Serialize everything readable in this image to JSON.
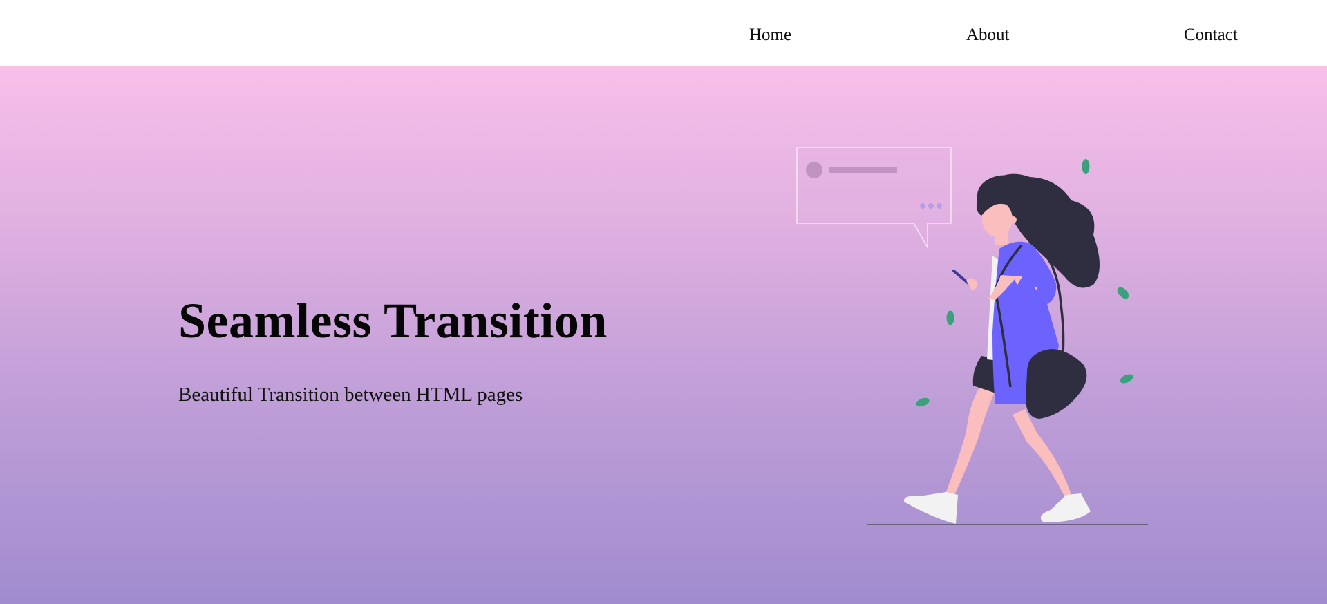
{
  "nav": {
    "items": [
      {
        "label": "Home"
      },
      {
        "label": "About"
      },
      {
        "label": "Contact"
      }
    ]
  },
  "hero": {
    "title": "Seamless Transition",
    "subtitle": "Beautiful Transition between HTML pages",
    "gradient_colors": [
      "#f8bfe9",
      "#a08ccf"
    ]
  },
  "illustration": {
    "icon": "walking-woman-with-phone-illustration",
    "colors": {
      "hair": "#2f2e41",
      "skin": "#fbbebe",
      "shirt": "#6c63ff",
      "bag": "#2f2e41",
      "shoes": "#f2f2f2",
      "leaves": "#3ba17c"
    }
  }
}
